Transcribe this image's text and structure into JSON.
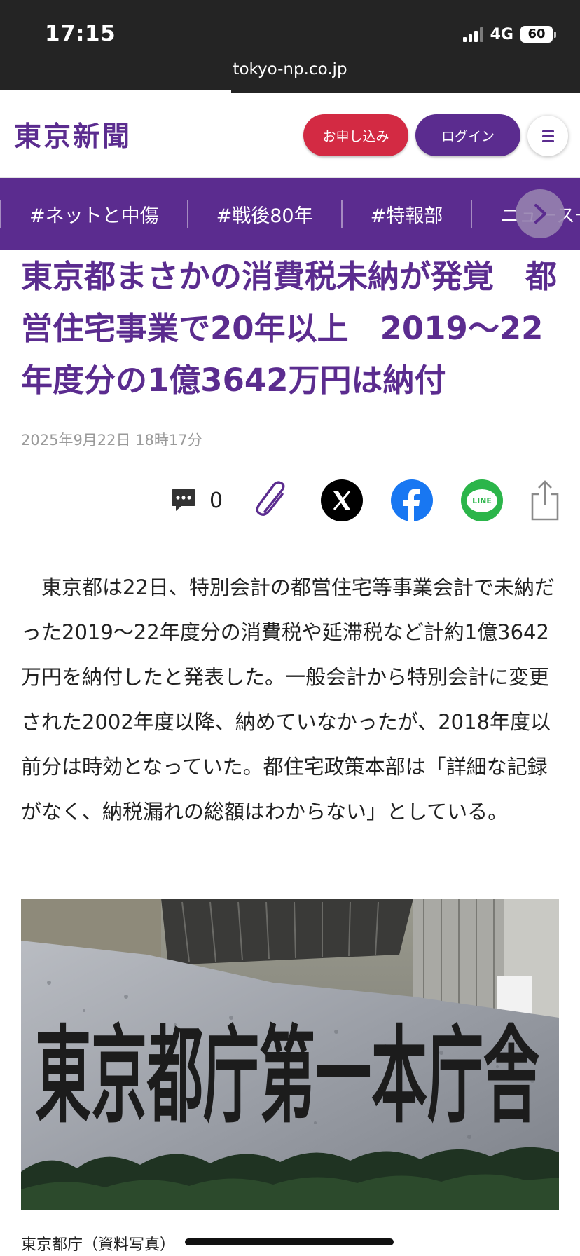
{
  "status": {
    "time": "17:15",
    "network": "4G",
    "battery": "60",
    "url": "tokyo-np.co.jp"
  },
  "header": {
    "logo": "東京新聞",
    "apply_label": "お申し込み",
    "login_label": "ログイン"
  },
  "topics": [
    "#ネットと中傷",
    "#戦後80年",
    "#特報部",
    "ニュース一"
  ],
  "article": {
    "headline": "東京都まさかの消費税未納が発覚　都営住宅事業で20年以上　2019～22年度分の1億3642万円は納付",
    "date": "2025年9月22日 18時17分",
    "comment_count": "0",
    "body": "東京都は22日、特別会計の都営住宅等事業会計で未納だった2019～22年度分の消費税や延滞税など計約1億3642万円を納付したと発表した。一般会計から特別会計に変更された2002年度以降、納めていなかったが、2018年度以前分は時効となっていた。都住宅政策本部は「詳細な記録がなく、納税漏れの総額はわからない」としている。",
    "photo_inscription": "東京都庁第一本庁舎",
    "caption": "東京都庁（資料写真）"
  },
  "share": {
    "icons": [
      "comment-icon",
      "clip-icon",
      "x-icon",
      "facebook-icon",
      "line-icon",
      "share-icon"
    ],
    "line_label": "LINE"
  },
  "colors": {
    "brand_purple": "#5b2c8f",
    "apply_red": "#d32a43",
    "status_bar": "#242424",
    "facebook": "#1877f2",
    "line": "#2bb54a"
  }
}
